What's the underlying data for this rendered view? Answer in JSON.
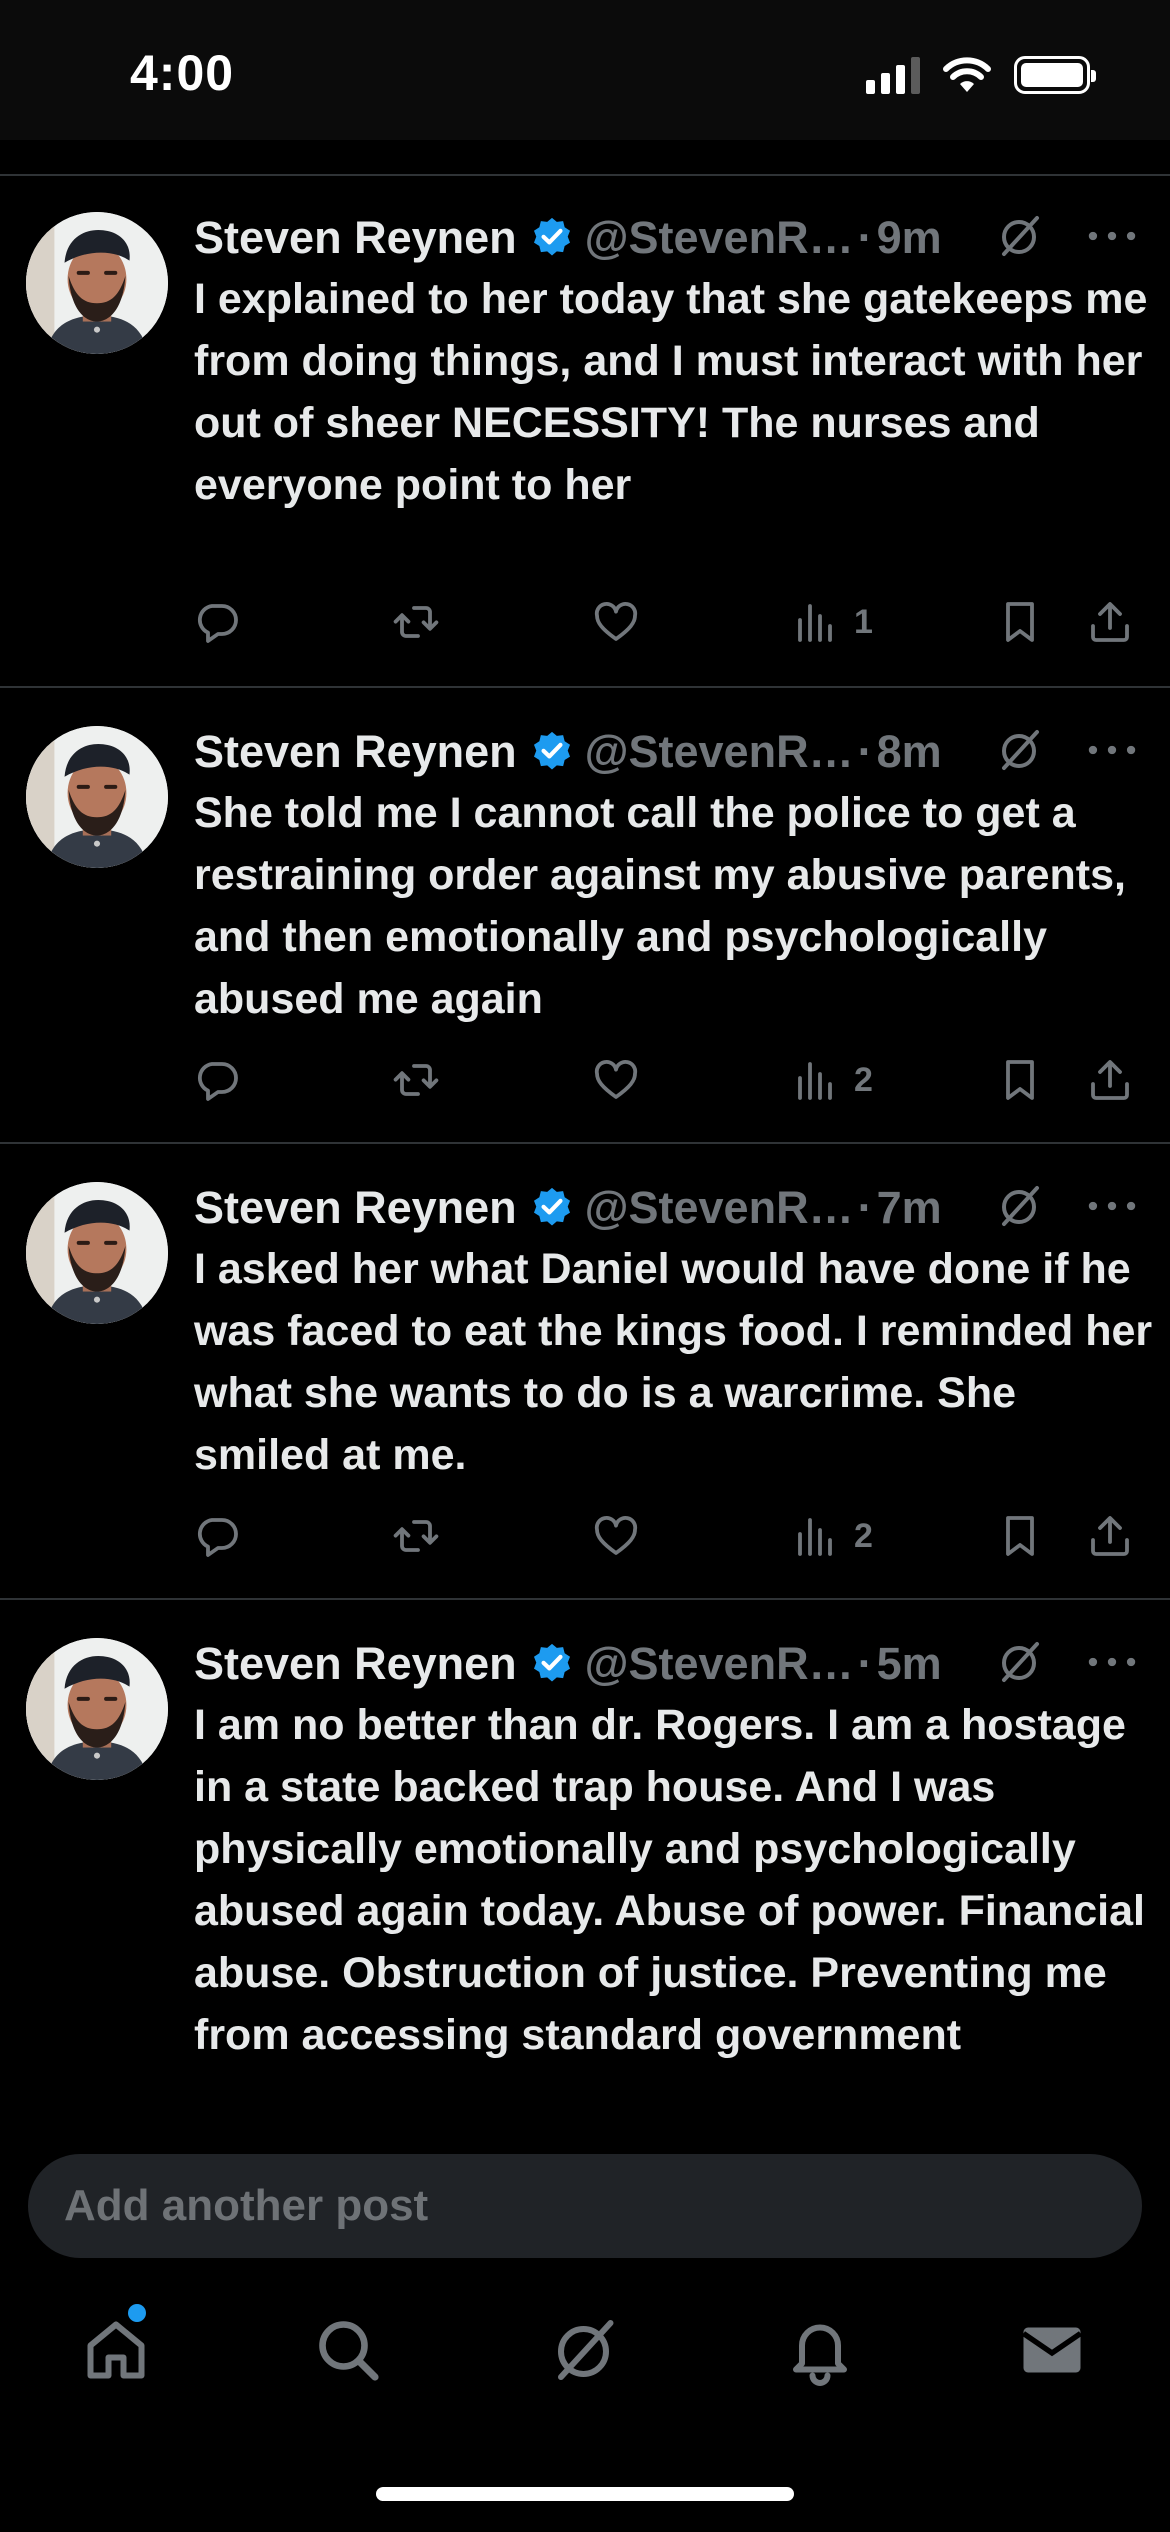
{
  "status_bar": {
    "time": "4:00"
  },
  "posts": [
    {
      "author": "Steven Reynen",
      "handle": "@StevenR…",
      "separator": "·",
      "time": "9m",
      "text": "I explained to her today that she gatekeeps me from doing things, and I must interact with her out of sheer NECESSITY! The nurses and everyone point to her",
      "views": "1"
    },
    {
      "author": "Steven Reynen",
      "handle": "@StevenR…",
      "separator": "·",
      "time": "8m",
      "text": "She told me I cannot call the police to get a restraining order against my abusive parents, and then emotionally and psychologically abused me again",
      "views": "2"
    },
    {
      "author": "Steven Reynen",
      "handle": "@StevenR…",
      "separator": "·",
      "time": "7m",
      "text": "I asked her what Daniel would have done if he was faced to eat the kings food. I reminded her what she wants to do is a warcrime. She smiled at me.",
      "views": "2"
    },
    {
      "author": "Steven Reynen",
      "handle": "@StevenR…",
      "separator": "·",
      "time": "5m",
      "text": "I am no better than dr. Rogers. I am a hostage in a state backed trap house. And I was physically emotionally and psychologically abused again today. Abuse of power. Financial abuse. Obstruction of justice. Preventing me from accessing standard government",
      "views": ""
    }
  ],
  "compose": {
    "placeholder": "Add another post"
  },
  "tab_bar": {
    "items": [
      "home-icon",
      "search-icon",
      "grok-icon",
      "notifications-icon",
      "messages-icon"
    ]
  },
  "colors": {
    "accent": "#1d9bf0",
    "background": "#000000",
    "muted": "#71767b",
    "text": "#e7e9ea",
    "divider": "#2f3336"
  }
}
